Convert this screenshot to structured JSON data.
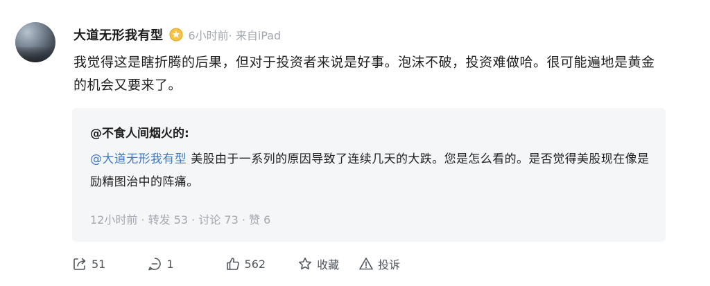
{
  "post": {
    "author": "大道无形我有型",
    "meta": "6小时前· 来自iPad",
    "text": "我觉得这是瞎折腾的后果，但对于投资者来说是好事。泡沫不破，投资难做哈。很可能遍地是黄金的机会又要来了。"
  },
  "quote": {
    "author": "@不食人间烟火的:",
    "mention": "@大道无形我有型",
    "text": "美股由于一系列的原因导致了连续几天的大跌。您是怎么看的。是否觉得美股现在像是励精图治中的阵痛。",
    "meta": "12小时前  · 转发 53 · 讨论 73 · 赞 6"
  },
  "actions": {
    "share_count": "51",
    "comment_count": "1",
    "like_count": "562",
    "favorite_label": "收藏",
    "report_label": "投诉"
  },
  "icons": {
    "badge": "gold-badge-icon",
    "share": "share-icon",
    "comment": "comment-icon",
    "like": "thumbs-up-icon",
    "favorite": "star-icon",
    "report": "warning-icon"
  },
  "colors": {
    "mention": "#3d78c5",
    "meta": "#a3a8ae",
    "quote_bg": "#f5f6f8",
    "badge": "#f0b429"
  }
}
